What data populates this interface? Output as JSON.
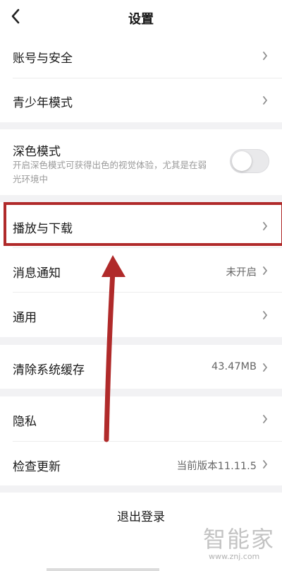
{
  "header": {
    "title": "设置"
  },
  "groups": {
    "account": {
      "label": "账号与安全"
    },
    "youth": {
      "label": "青少年模式"
    },
    "dark_mode": {
      "label": "深色模式",
      "desc_line1": "开启深色模式可获得出色的视觉体验，尤其是在弱",
      "desc_line2": "光环境中",
      "enabled": false
    },
    "play_download": {
      "label": "播放与下载"
    },
    "notifications": {
      "label": "消息通知",
      "value": "未开启"
    },
    "general": {
      "label": "通用"
    },
    "clear_cache": {
      "label": "清除系统缓存",
      "value": "43.47MB"
    },
    "privacy": {
      "label": "隐私"
    },
    "check_update": {
      "label": "检查更新",
      "value": "当前版本11.11.5"
    },
    "logout": {
      "label": "退出登录"
    }
  },
  "watermark": {
    "text": "智能家",
    "url": "www.znj.com"
  },
  "colors": {
    "highlight": "#b02a2a",
    "arrow": "#b02a2a"
  }
}
